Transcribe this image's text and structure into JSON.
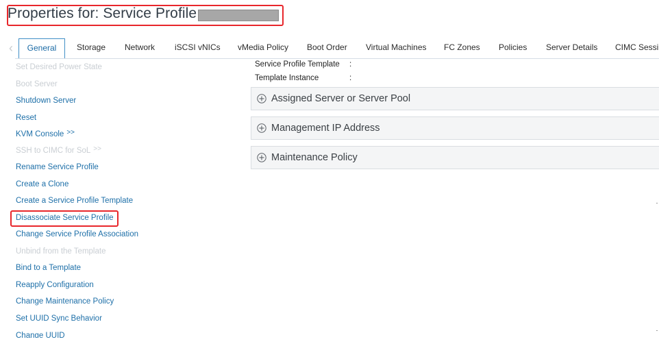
{
  "header": {
    "title": "Properties for: Service Profile"
  },
  "tabs": [
    {
      "label": "General"
    },
    {
      "label": "Storage"
    },
    {
      "label": "Network"
    },
    {
      "label": "iSCSI vNICs"
    },
    {
      "label": "vMedia Policy"
    },
    {
      "label": "Boot Order"
    },
    {
      "label": "Virtual Machines"
    },
    {
      "label": "FC Zones"
    },
    {
      "label": "Policies"
    },
    {
      "label": "Server Details"
    },
    {
      "label": "CIMC Sessi"
    }
  ],
  "active_tab": "General",
  "actions": [
    {
      "label": "Set Desired Power State",
      "enabled": false
    },
    {
      "label": "Boot Server",
      "enabled": false
    },
    {
      "label": "Shutdown Server",
      "enabled": true
    },
    {
      "label": "Reset",
      "enabled": true
    },
    {
      "label": "KVM Console",
      "suffix": ">>",
      "enabled": true
    },
    {
      "label": "SSH to CIMC for SoL",
      "suffix": ">>",
      "enabled": false
    },
    {
      "label": "Rename Service Profile",
      "enabled": true
    },
    {
      "label": "Create a Clone",
      "enabled": true
    },
    {
      "label": "Create a Service Profile Template",
      "enabled": true
    },
    {
      "label": "Disassociate Service Profile",
      "enabled": true,
      "highlighted": true
    },
    {
      "label": "Change Service Profile Association",
      "enabled": true
    },
    {
      "label": "Unbind from the Template",
      "enabled": false
    },
    {
      "label": "Bind to a Template",
      "enabled": true
    },
    {
      "label": "Reapply Configuration",
      "enabled": true
    },
    {
      "label": "Change Maintenance Policy",
      "enabled": true
    },
    {
      "label": "Set UUID Sync Behavior",
      "enabled": true
    },
    {
      "label": "Change UUID",
      "enabled": true
    }
  ],
  "properties": {
    "service_profile_template_label": "Service Profile Template",
    "service_profile_template_colon": ":",
    "template_instance_label": "Template Instance",
    "template_instance_colon": ":"
  },
  "sections": [
    {
      "label": "Assigned Server or Server Pool"
    },
    {
      "label": "Management IP Address"
    },
    {
      "label": "Maintenance Policy"
    }
  ],
  "colors": {
    "link": "#1d6fa8",
    "disabled": "#c9ced3",
    "highlight_border": "#e8262b",
    "active_tab_border": "#3f8fc6"
  }
}
